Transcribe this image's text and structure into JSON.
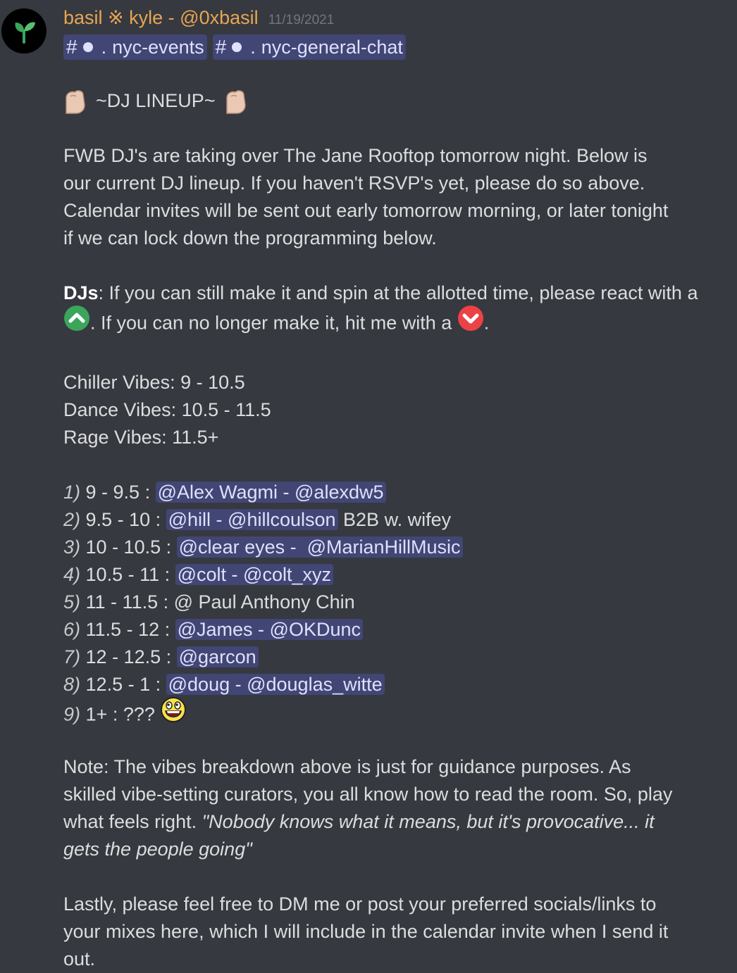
{
  "message": {
    "author": "basil ※ kyle - @0xbasil",
    "timestamp": "11/19/2021",
    "channels": [
      {
        "hash": "#",
        "sep": ".",
        "name": "nyc-events"
      },
      {
        "hash": "#",
        "sep": ".",
        "name": "nyc-general-chat"
      }
    ],
    "title": "~DJ LINEUP~",
    "intro": "FWB DJ's are taking over The Jane Rooftop tomorrow night. Below is our current DJ lineup. If you haven't RSVP's yet, please do so above. Calendar invites will be sent out early tomorrow morning, or later tonight if we can lock down the programming below.",
    "djs": {
      "bold": "DJs",
      "text1": ": If you can still make it and spin at the allotted time, please react with a",
      "text2": ". If you can no longer make it, hit me with a",
      "text3": "."
    },
    "vibes": [
      "Chiller Vibes: 9 - 10.5",
      "Dance Vibes: 10.5 - 11.5",
      "Rage Vibes: 11.5+"
    ],
    "lineup": [
      {
        "num": "1)",
        "time": "9 - 9.5 :",
        "mention": "@Alex Wagmi - @alexdw5",
        "after": ""
      },
      {
        "num": "2)",
        "time": "9.5 - 10 :",
        "mention": "@hill - @hillcoulson",
        "after": " B2B w. wifey"
      },
      {
        "num": "3)",
        "time": "10 - 10.5 :",
        "mention": "@clear eyes -  @MarianHillMusic",
        "after": ""
      },
      {
        "num": "4)",
        "time": "10.5 - 11 :",
        "mention": "@colt - @colt_xyz",
        "after": ""
      },
      {
        "num": "5)",
        "time": "11 - 11.5 :",
        "mention": "",
        "after": "@ Paul Anthony Chin"
      },
      {
        "num": "6)",
        "time": "11.5 - 12 :",
        "mention": "@James - @OKDunc",
        "after": ""
      },
      {
        "num": "7)",
        "time": "12 - 12.5 :",
        "mention": "@garcon",
        "after": ""
      },
      {
        "num": "8)",
        "time": "12.5 - 1 :",
        "mention": "@doug - @douglas_witte",
        "after": ""
      },
      {
        "num": "9)",
        "time": "1+ : ???",
        "mention": "",
        "after": ""
      }
    ],
    "note_plain": "Note: The vibes breakdown above is just for guidance purposes. As skilled vibe-setting curators, you all know how to read the room. So, play what feels right. ",
    "note_quote": "\"Nobody knows what it means, but it's provocative... it gets the people going\"",
    "closing": "Lastly, please feel free to DM me or post your preferred socials/links to your mixes here, which I will include in the calendar invite when I send it out."
  },
  "colors": {
    "background": "#36393f",
    "username": "#e8a552",
    "mention_bg": "#414675",
    "mention_text": "#dee0fc",
    "upvote": "#3ba55c",
    "downvote": "#ed4245"
  },
  "icons": {
    "avatar": "sprout-icon",
    "title_emoji": "pepe-hand-icon",
    "upvote": "green-up-arrow-icon",
    "downvote": "red-down-arrow-icon",
    "laugh": "awesome-face-icon"
  }
}
